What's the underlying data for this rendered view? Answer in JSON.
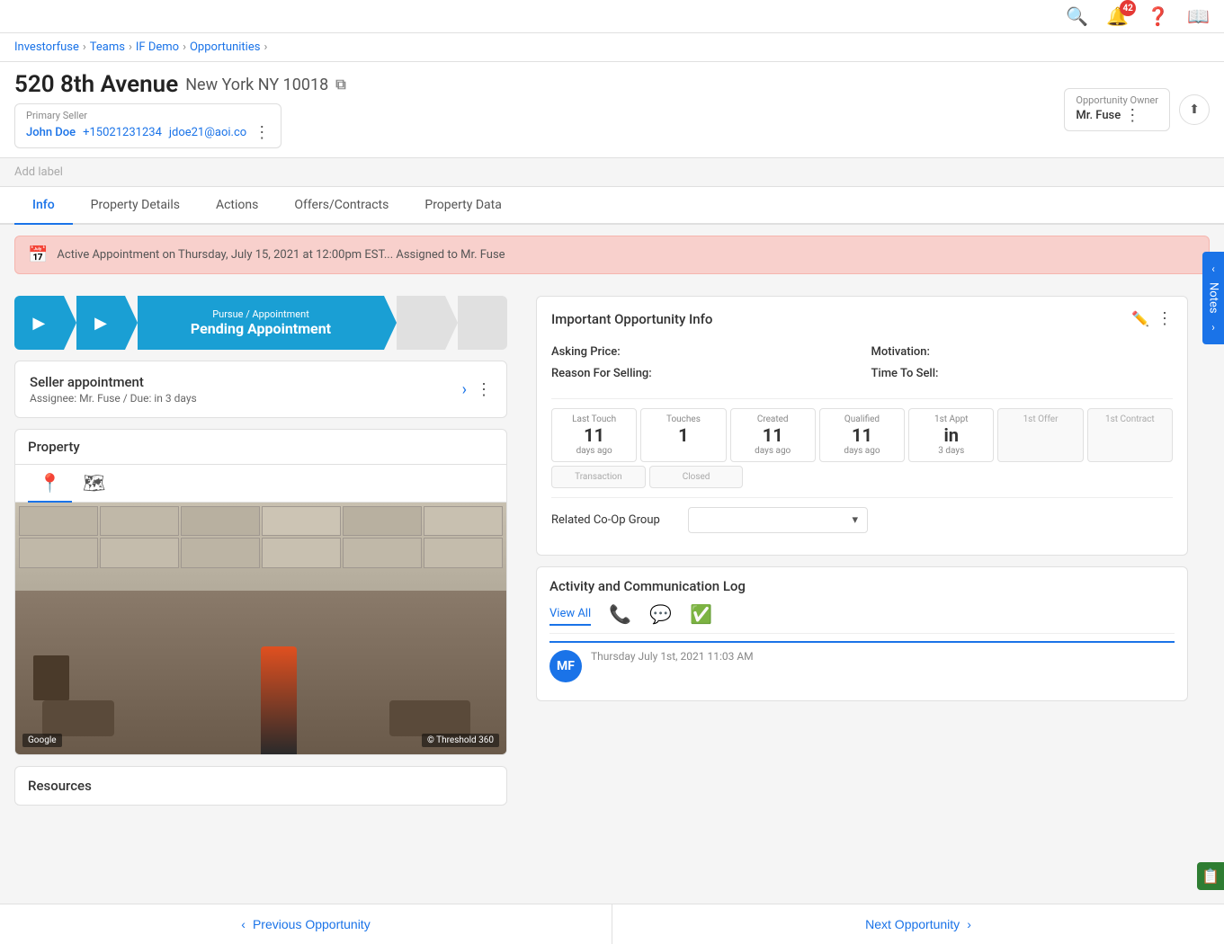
{
  "breadcrumb": {
    "items": [
      "Investorfuse",
      "Teams",
      "IF Demo",
      "Opportunities"
    ]
  },
  "header": {
    "address": "520 8th Avenue",
    "address_sub": "New York NY 10018",
    "copy_icon": "⧉",
    "seller": {
      "label": "Primary Seller",
      "name": "John Doe",
      "phone": "+15021231234",
      "email": "jdoe21@aoi.co"
    },
    "opportunity_owner": {
      "label": "Opportunity Owner",
      "name": "Mr. Fuse"
    },
    "notification_count": "42"
  },
  "add_label": "Add label",
  "tabs": [
    "Info",
    "Property Details",
    "Actions",
    "Offers/Contracts",
    "Property Data"
  ],
  "active_tab": "Info",
  "alert": {
    "text": "Active Appointment on Thursday, July 15, 2021 at 12:00pm EST... Assigned to Mr. Fuse"
  },
  "pipeline": {
    "steps": [
      {
        "label": "",
        "active": true,
        "small": true
      },
      {
        "label": "",
        "active": true,
        "small": true
      },
      {
        "title": "Pursue / Appointment",
        "main": "Pending Appointment",
        "active": true,
        "center": true
      },
      {
        "label": "",
        "active": false,
        "small": true
      },
      {
        "label": "",
        "active": false,
        "small": true
      }
    ]
  },
  "seller_appointment": {
    "title": "Seller appointment",
    "subtitle": "Assignee: Mr. Fuse / Due: in 3 days"
  },
  "property": {
    "label": "Property",
    "google_label": "Google",
    "threshold_label": "© Threshold 360"
  },
  "resources": {
    "label": "Resources"
  },
  "important_info": {
    "title": "Important Opportunity Info",
    "asking_price_label": "Asking Price:",
    "asking_price_value": "",
    "motivation_label": "Motivation:",
    "motivation_value": "",
    "reason_label": "Reason For Selling:",
    "reason_value": "",
    "time_to_sell_label": "Time To Sell:",
    "time_to_sell_value": ""
  },
  "stats": [
    {
      "label": "Last Touch",
      "value": "11",
      "sub": "days ago"
    },
    {
      "label": "Touches",
      "value": "1",
      "sub": ""
    },
    {
      "label": "Created",
      "value": "11",
      "sub": "days ago"
    },
    {
      "label": "Qualified",
      "value": "11",
      "sub": "days ago"
    },
    {
      "label": "1st Appt",
      "value": "in",
      "sub": "3 days"
    },
    {
      "label": "1st Offer",
      "value": "",
      "sub": ""
    },
    {
      "label": "1st Contract",
      "value": "",
      "sub": ""
    },
    {
      "label": "Transaction",
      "value": "",
      "sub": ""
    },
    {
      "label": "Closed",
      "value": "",
      "sub": ""
    }
  ],
  "coop": {
    "label": "Related Co-Op Group",
    "placeholder": ""
  },
  "activity_log": {
    "title": "Activity and Communication Log",
    "tabs": [
      "View All"
    ],
    "entry_time": "Thursday July 1st, 2021 11:03 AM",
    "avatar_initials": "MF"
  },
  "notes_sidebar": {
    "label": "Notes"
  },
  "bottom_nav": {
    "prev": "Previous Opportunity",
    "next": "Next Opportunity"
  }
}
